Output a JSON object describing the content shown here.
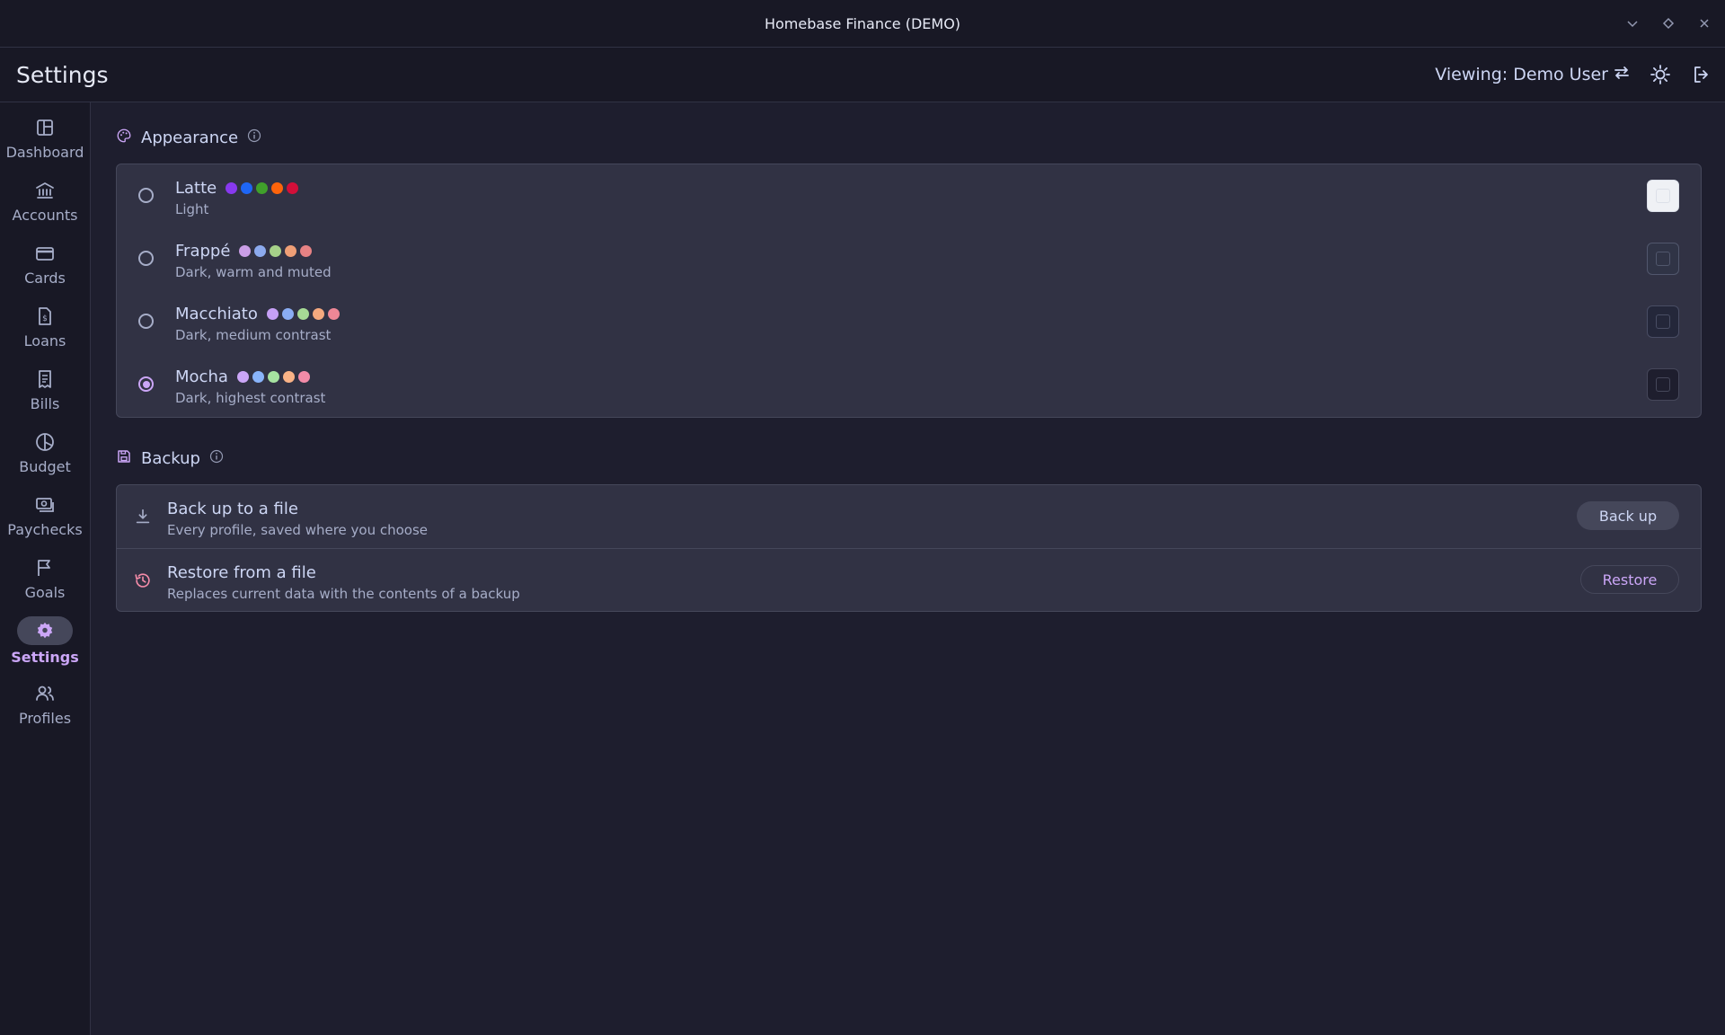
{
  "window": {
    "title": "Homebase Finance (DEMO)"
  },
  "header": {
    "page_title": "Settings",
    "viewing_label": "Viewing: Demo User"
  },
  "sidebar": {
    "items": [
      {
        "label": "Dashboard",
        "icon": "dashboard-icon"
      },
      {
        "label": "Accounts",
        "icon": "bank-icon"
      },
      {
        "label": "Cards",
        "icon": "credit-card-icon"
      },
      {
        "label": "Loans",
        "icon": "loan-document-icon"
      },
      {
        "label": "Bills",
        "icon": "receipt-icon"
      },
      {
        "label": "Budget",
        "icon": "pie-chart-icon"
      },
      {
        "label": "Paychecks",
        "icon": "cash-icon"
      },
      {
        "label": "Goals",
        "icon": "flag-icon"
      },
      {
        "label": "Settings",
        "icon": "gear-icon",
        "active": true
      },
      {
        "label": "Profiles",
        "icon": "users-icon"
      }
    ]
  },
  "appearance": {
    "title": "Appearance",
    "themes": [
      {
        "name": "Latte",
        "description": "Light",
        "selected": false,
        "dots": [
          "#8839ef",
          "#1e66f5",
          "#40a02b",
          "#fe640b",
          "#d20f39"
        ],
        "swatch_bg": "#eff1f5",
        "swatch_border": "#dce0e8"
      },
      {
        "name": "Frappé",
        "description": "Dark, warm and muted",
        "selected": false,
        "dots": [
          "#ca9ee6",
          "#8caaee",
          "#a6d189",
          "#ef9f76",
          "#e78284"
        ],
        "swatch_bg": "#303446",
        "swatch_border": "#51576d"
      },
      {
        "name": "Macchiato",
        "description": "Dark, medium contrast",
        "selected": false,
        "dots": [
          "#c6a0f6",
          "#8aadf4",
          "#a6da95",
          "#f5a97f",
          "#ed8796"
        ],
        "swatch_bg": "#24273a",
        "swatch_border": "#494d64"
      },
      {
        "name": "Mocha",
        "description": "Dark, highest contrast",
        "selected": true,
        "dots": [
          "#cba6f7",
          "#89b4fa",
          "#a6e3a1",
          "#fab387",
          "#f38ba8"
        ],
        "swatch_bg": "#1e1e2e",
        "swatch_border": "#45475a"
      }
    ]
  },
  "backup": {
    "title": "Backup",
    "items": [
      {
        "title": "Back up to a file",
        "description": "Every profile, saved where you choose",
        "button": "Back up",
        "icon": "download-icon"
      },
      {
        "title": "Restore from a file",
        "description": "Replaces current data with the contents of a backup",
        "button": "Restore",
        "icon": "history-icon"
      }
    ]
  },
  "colors": {
    "accent": "#cba6f7",
    "danger": "#f38ba8",
    "base": "#1e1e2e",
    "mantle": "#181825"
  }
}
